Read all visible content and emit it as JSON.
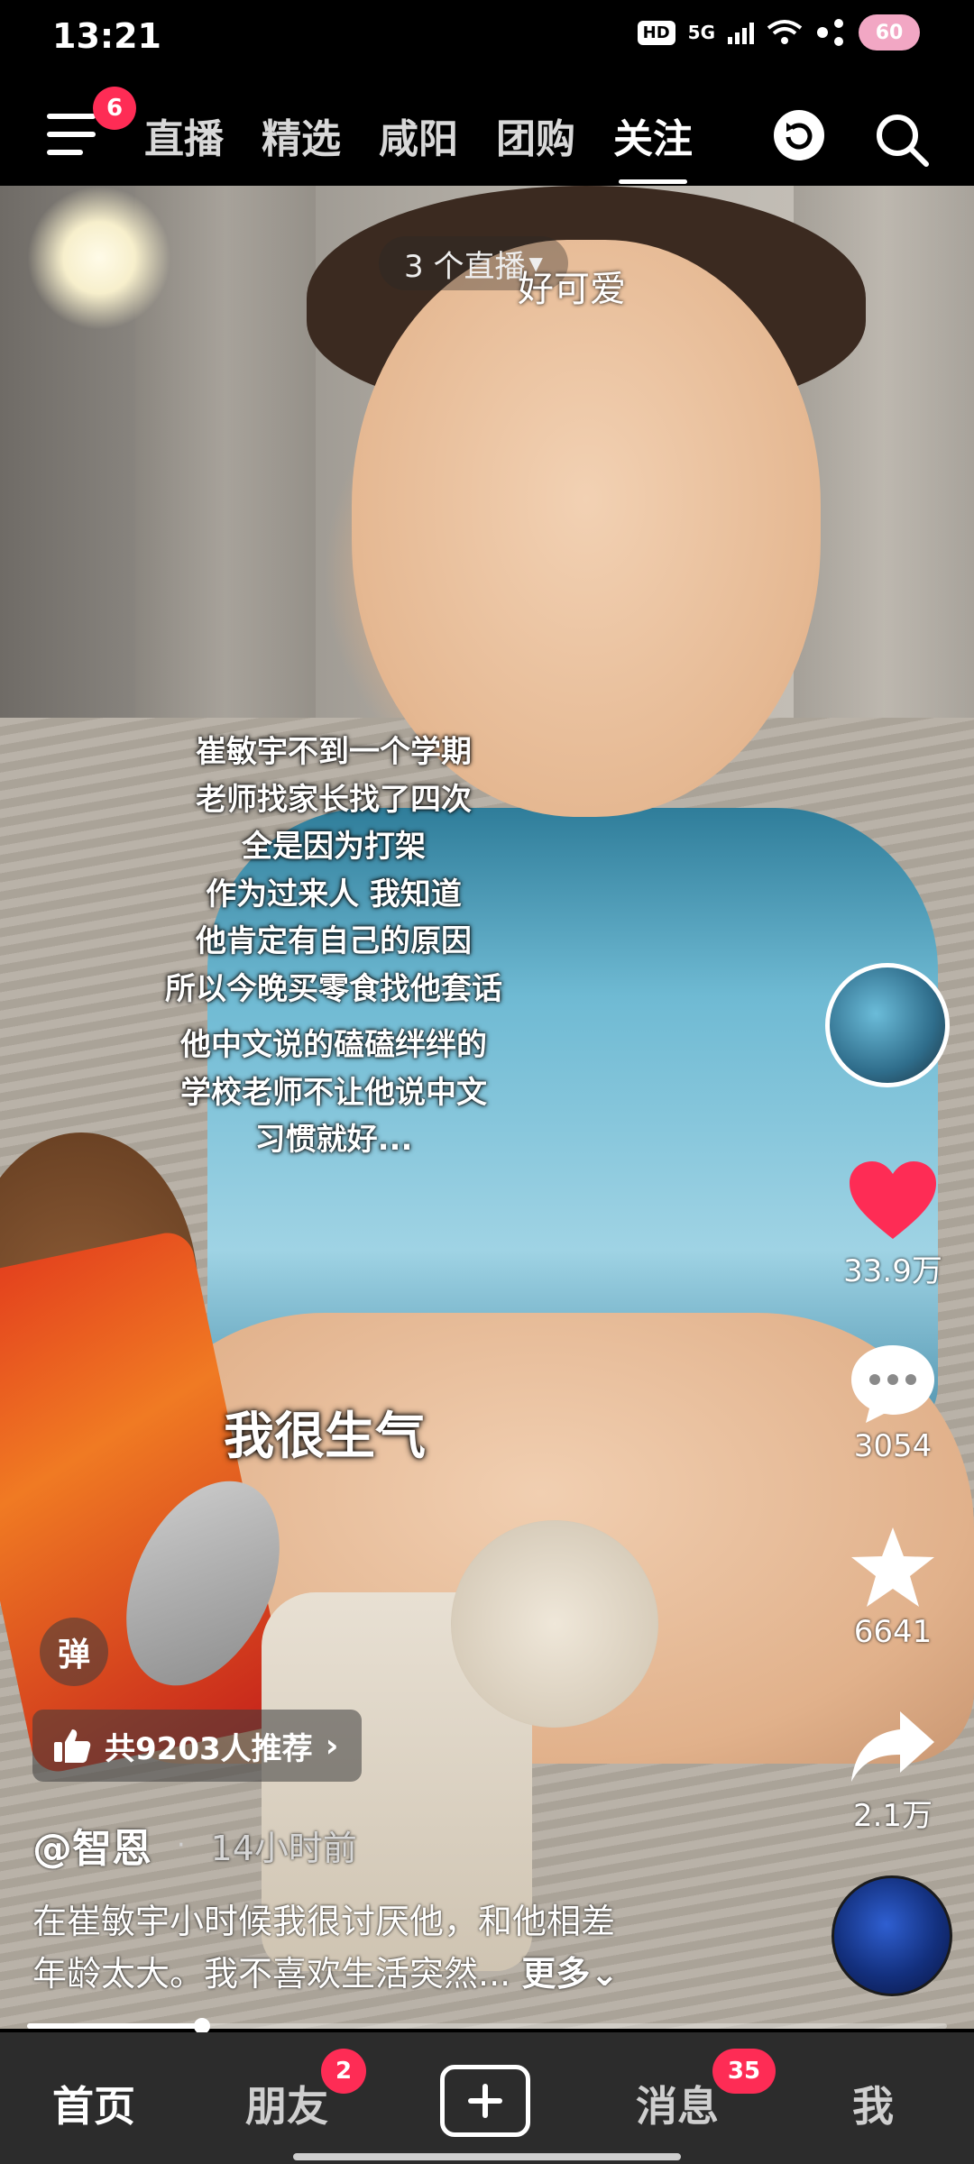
{
  "status_bar": {
    "time": "13:21",
    "hd": "HD",
    "network": "5G",
    "battery": "60"
  },
  "top_nav": {
    "menu_badge": "6",
    "tabs": [
      {
        "label": "直播",
        "active": false
      },
      {
        "label": "精选",
        "active": false
      },
      {
        "label": "咸阳",
        "active": false
      },
      {
        "label": "团购",
        "active": false
      },
      {
        "label": "关注",
        "active": true
      }
    ],
    "icons": {
      "menu": "menu-icon",
      "refresh": "refresh-icon",
      "search": "search-icon"
    }
  },
  "video": {
    "live_pill": "3 个直播",
    "danmaku": "好可爱",
    "caption_lines_1": [
      "崔敏宇不到一个学期",
      "老师找家长找了四次",
      "全是因为打架",
      "作为过来人 我知道",
      "他肯定有自己的原因",
      "所以今晚买零食找他套话"
    ],
    "caption_lines_2": [
      "他中文说的磕磕绊绊的",
      "学校老师不让他说中文",
      "习惯就好..."
    ],
    "subtitle": "我很生气",
    "progress": 0.19
  },
  "rail": {
    "like_count": "33.9万",
    "comment_count": "3054",
    "favorite_count": "6641",
    "share_count": "2.1万",
    "like_color": "#fe2c55"
  },
  "info": {
    "danmu_label": "弹",
    "recommend_text": "共9203人推荐",
    "author": "@智恩",
    "separator": "·",
    "time_ago": "14小时前",
    "desc_line1": "在崔敏宇小时候我很讨厌他，和他相差",
    "desc_line2": "年龄太大。我不喜欢生活突然...",
    "more_label": "更多"
  },
  "tab_bar": {
    "home": "首页",
    "friends": "朋友",
    "friends_badge": "2",
    "messages": "消息",
    "messages_badge": "35",
    "me": "我"
  }
}
